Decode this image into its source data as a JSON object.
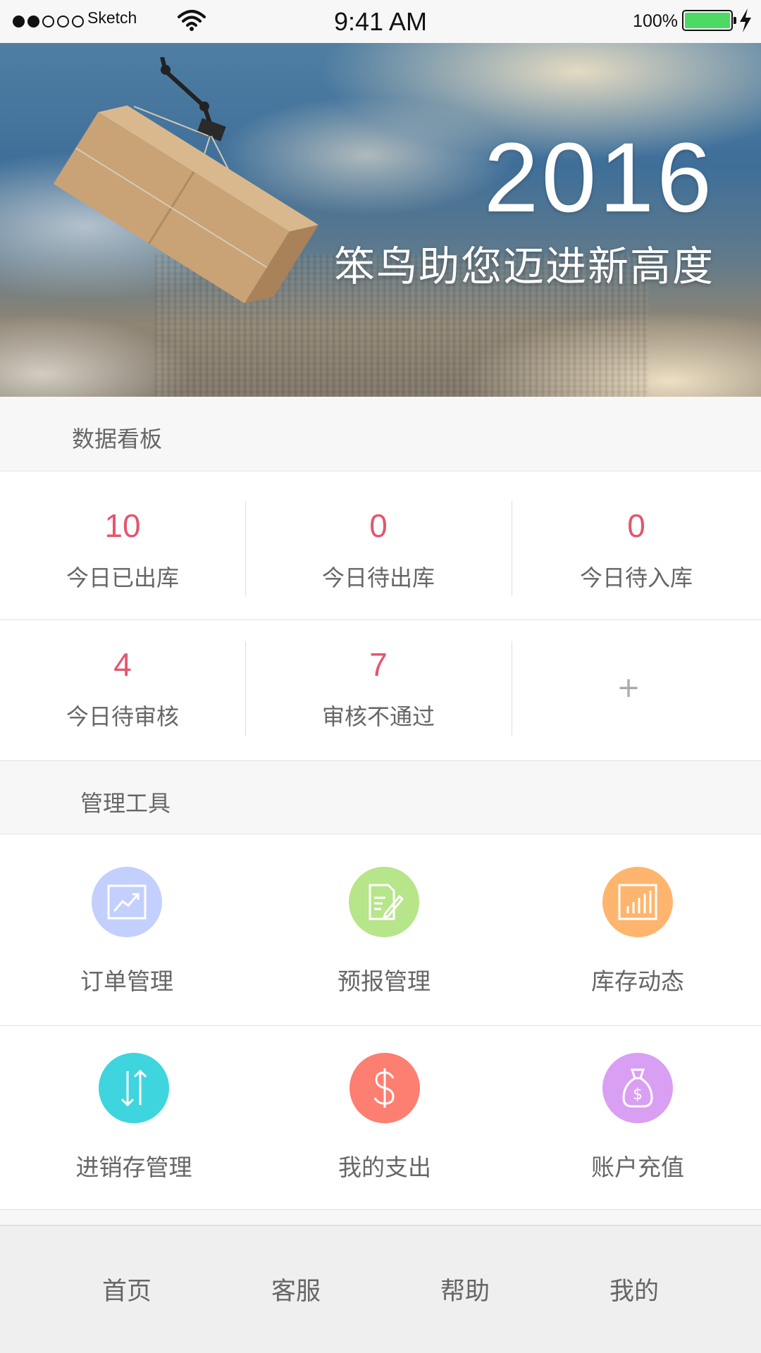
{
  "status_bar": {
    "carrier": "Sketch",
    "time": "9:41 AM",
    "battery_pct": "100%",
    "battery_color": "#4cd964"
  },
  "banner": {
    "year": "2016",
    "slogan": "笨鸟助您迈进新高度"
  },
  "data_board": {
    "title": "数据看板",
    "accent_color": "#e2576d",
    "stats": [
      {
        "value": "10",
        "label": "今日已出库"
      },
      {
        "value": "0",
        "label": "今日待出库"
      },
      {
        "value": "0",
        "label": "今日待入库"
      },
      {
        "value": "4",
        "label": "今日待审核"
      },
      {
        "value": "7",
        "label": "审核不通过"
      }
    ],
    "add_label": "+"
  },
  "tools": {
    "title": "管理工具",
    "items": [
      {
        "label": "订单管理",
        "icon": "trend-chart-icon",
        "color": "#c3d0fd"
      },
      {
        "label": "预报管理",
        "icon": "document-edit-icon",
        "color": "#b7e58a"
      },
      {
        "label": "库存动态",
        "icon": "bar-chart-icon",
        "color": "#ffb56d"
      },
      {
        "label": "进销存管理",
        "icon": "up-down-arrows-icon",
        "color": "#3ed5de"
      },
      {
        "label": "我的支出",
        "icon": "dollar-icon",
        "color": "#fc7f72"
      },
      {
        "label": "账户充值",
        "icon": "money-bag-icon",
        "color": "#d99ff3"
      }
    ]
  },
  "bottom_nav": {
    "items": [
      "首页",
      "客服",
      "帮助",
      "我的"
    ]
  }
}
